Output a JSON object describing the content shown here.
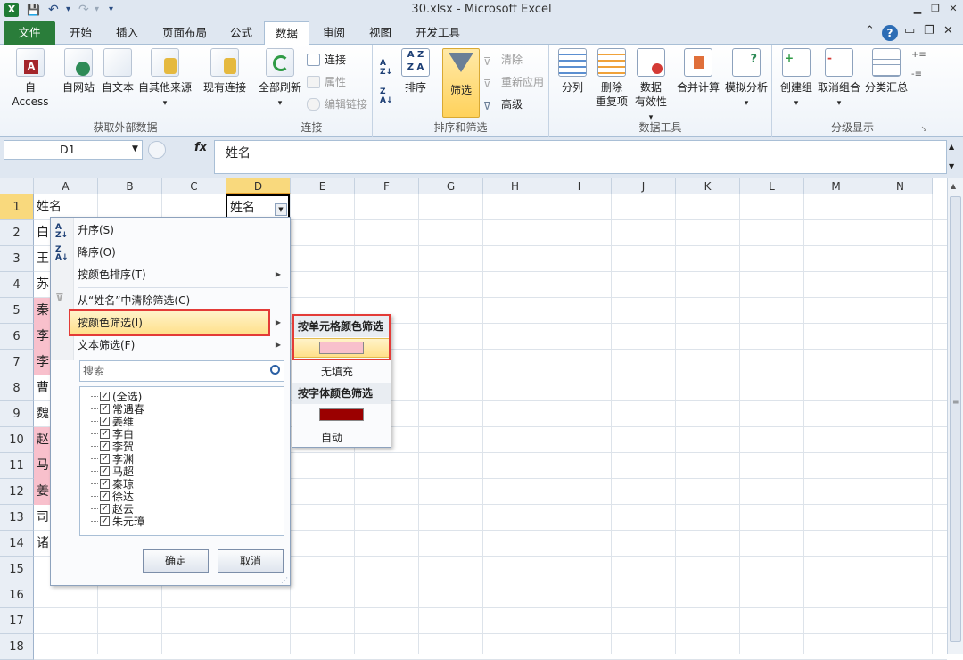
{
  "window": {
    "title": "30.xlsx - Microsoft Excel",
    "app_icon": "X"
  },
  "quick_access": {
    "save": "💾",
    "undo": "↶",
    "redo": "↷",
    "more": "▾"
  },
  "tabs": [
    "文件",
    "开始",
    "插入",
    "页面布局",
    "公式",
    "数据",
    "审阅",
    "视图",
    "开发工具"
  ],
  "active_tab": "数据",
  "ribbon": {
    "get_external": {
      "label": "获取外部数据",
      "buttons": [
        "自 Access",
        "自网站",
        "自文本",
        "自其他来源",
        "现有连接"
      ]
    },
    "connections": {
      "label": "连接",
      "refresh_all": "全部刷新",
      "items": [
        "连接",
        "属性",
        "编辑链接"
      ]
    },
    "sort_filter": {
      "label": "排序和筛选",
      "sort": "排序",
      "filter": "筛选",
      "items": [
        "清除",
        "重新应用",
        "高级"
      ]
    },
    "data_tools": {
      "label": "数据工具",
      "buttons": [
        "分列",
        "删除",
        "重复项",
        "数据",
        "有效性",
        "合并计算",
        "模拟分析"
      ]
    },
    "outline": {
      "label": "分级显示",
      "buttons": [
        "创建组",
        "取消组合",
        "分类汇总"
      ]
    }
  },
  "formula_bar": {
    "name_box": "D1",
    "fx": "fx",
    "formula": "姓名"
  },
  "columns": [
    "A",
    "B",
    "C",
    "D",
    "E",
    "F",
    "G",
    "H",
    "I",
    "J",
    "K",
    "L",
    "M",
    "N"
  ],
  "rows": [
    "1",
    "2",
    "3",
    "4",
    "5",
    "6",
    "7",
    "8",
    "9",
    "10",
    "11",
    "12",
    "13",
    "14",
    "15",
    "16",
    "17",
    "18"
  ],
  "col_a_cells": [
    "姓名",
    "白",
    "王",
    "苏",
    "秦",
    "李",
    "李",
    "曹",
    "魏",
    "赵",
    "马",
    "姜",
    "司",
    "诸"
  ],
  "d1_value": "姓名",
  "dropdown": {
    "sort_asc": "升序(S)",
    "sort_desc": "降序(O)",
    "sort_by_color": "按颜色排序(T)",
    "clear_filter": "从“姓名”中清除筛选(C)",
    "filter_by_color": "按颜色筛选(I)",
    "text_filter": "文本筛选(F)",
    "search_placeholder": "搜索",
    "checklist": [
      "(全选)",
      "常遇春",
      "姜维",
      "李白",
      "李贺",
      "李渊",
      "马超",
      "秦琼",
      "徐达",
      "赵云",
      "朱元璋"
    ],
    "ok": "确定",
    "cancel": "取消"
  },
  "submenu": {
    "cell_color_header": "按单元格颜色筛选",
    "no_fill": "无填充",
    "font_color_header": "按字体颜色筛选",
    "auto": "自动"
  },
  "colors": {
    "pink_fill": "#f8c0cc",
    "dark_red_font": "#9b0000",
    "highlight_red": "#e33b37",
    "excel_green": "#2a7d3a"
  }
}
